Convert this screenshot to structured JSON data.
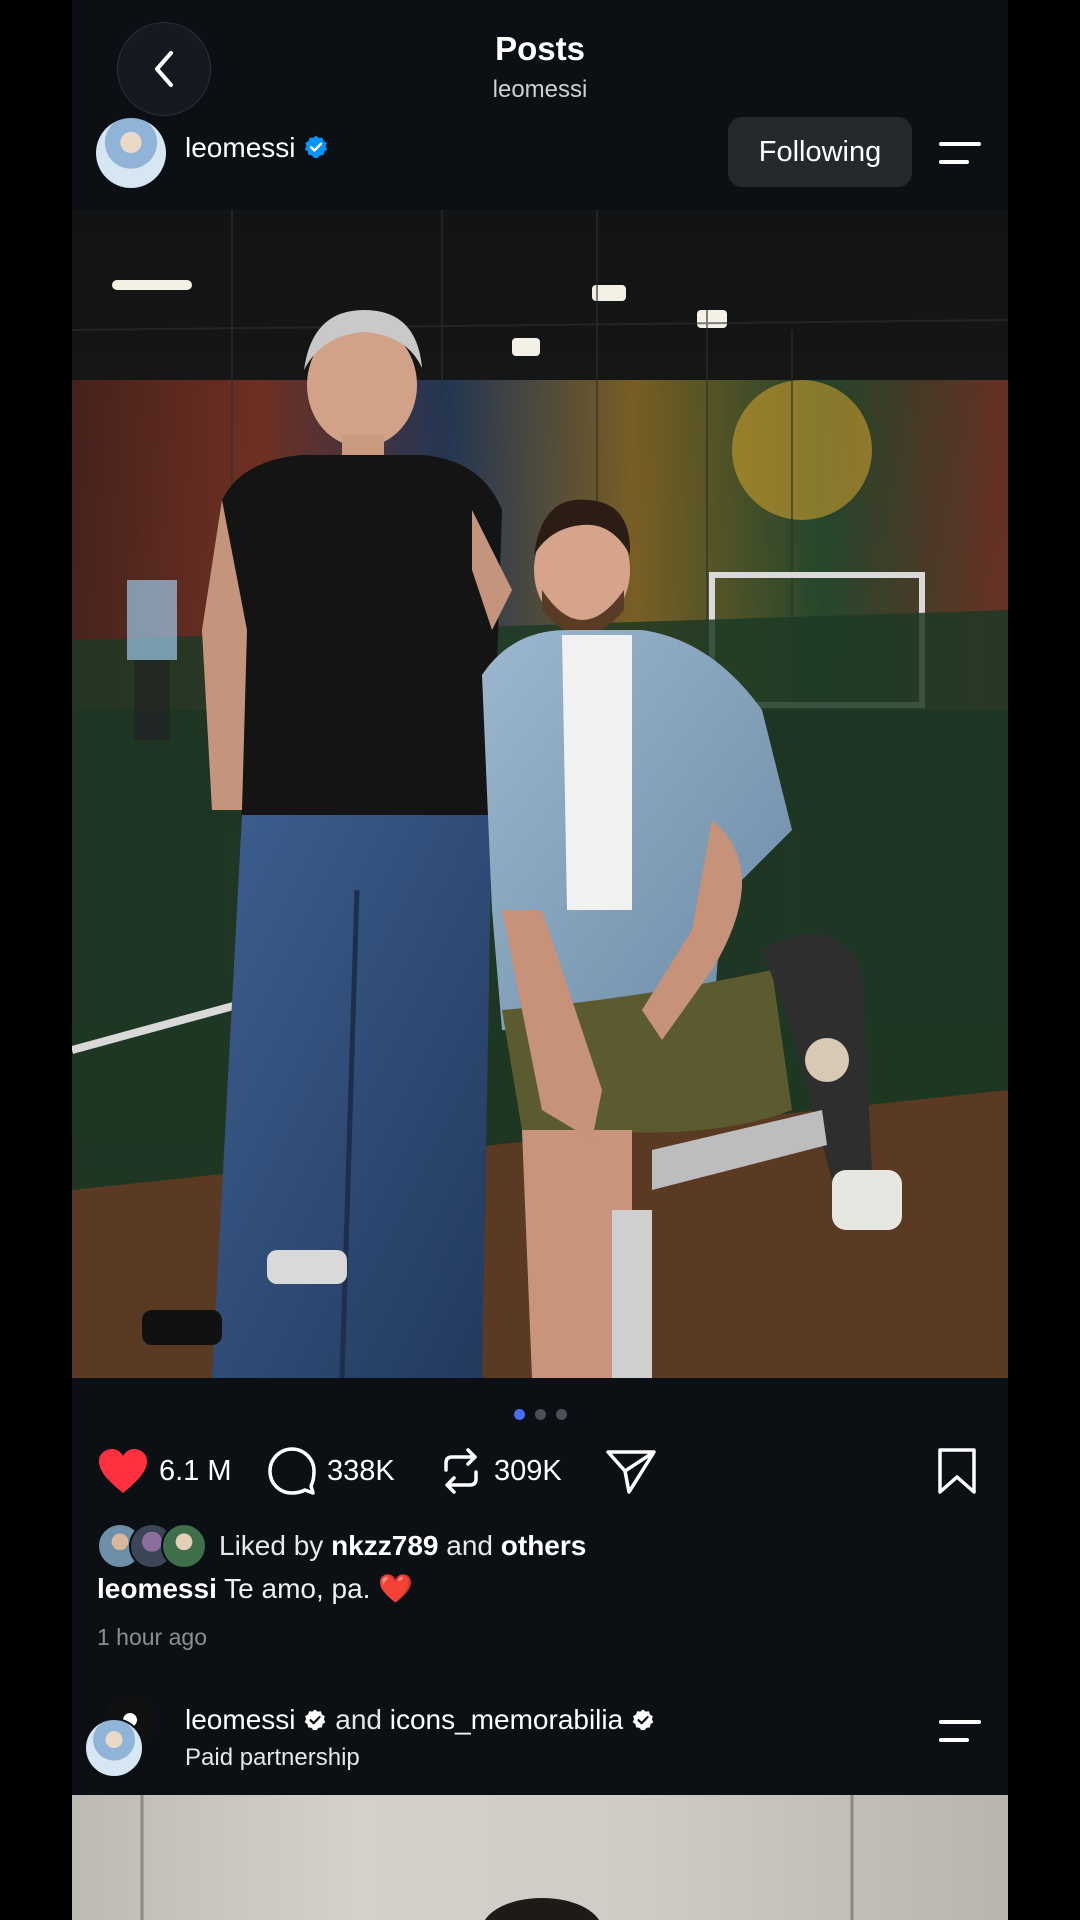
{
  "nav": {
    "title": "Posts",
    "subtitle": "leomessi"
  },
  "post": {
    "username": "leomessi",
    "verified": true,
    "follow_label": "Following",
    "image_count": 3,
    "active_image": 1,
    "likes": "6.1 M",
    "comments": "338K",
    "reposts": "309K",
    "liked_by_prefix": "Liked by",
    "liked_by_user": "nkzz789",
    "liked_by_and": "and",
    "liked_by_others": "others",
    "caption_user": "leomessi",
    "caption_text": "Te amo, pa.",
    "caption_emoji": "❤️",
    "time": "1 hour ago"
  },
  "post2": {
    "user1": "leomessi",
    "and": "and",
    "user2": "icons_memorabilia",
    "subtitle": "Paid partnership"
  },
  "colors": {
    "background": "#0c1014",
    "like_red": "#ff3040",
    "verified_blue": "#0095f6",
    "active_dot": "#4a6cf7"
  },
  "icons": [
    "chevron-left-icon",
    "verified-badge-icon",
    "menu-icon",
    "heart-icon",
    "comment-icon",
    "repost-icon",
    "share-icon",
    "bookmark-icon"
  ]
}
